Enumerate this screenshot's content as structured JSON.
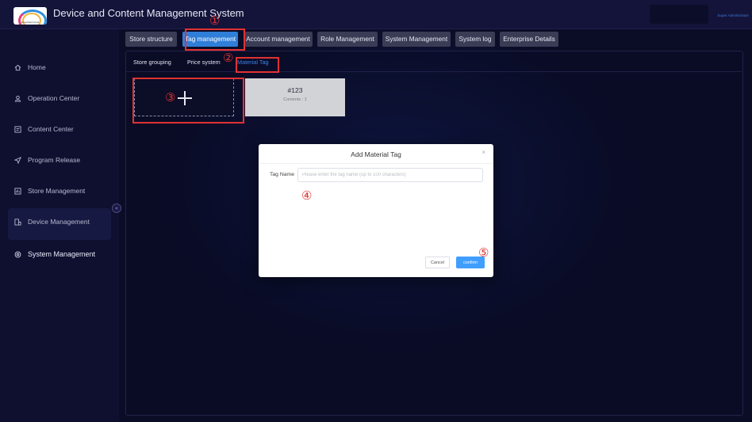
{
  "header": {
    "logo_text": "Greenfield Cloud",
    "title": "Device and Content Management System",
    "user_role": "Super Administrator"
  },
  "sidebar": {
    "items": [
      {
        "label": "Home",
        "icon": "home-icon"
      },
      {
        "label": "Operation Center",
        "icon": "operation-icon"
      },
      {
        "label": "Content Center",
        "icon": "content-icon"
      },
      {
        "label": "Program Release",
        "icon": "send-icon"
      },
      {
        "label": "Store Management",
        "icon": "store-icon"
      },
      {
        "label": "Device Management",
        "icon": "device-icon"
      },
      {
        "label": "System Management",
        "icon": "settings-icon",
        "active": true
      }
    ],
    "collapse_glyph": "«"
  },
  "tabs": [
    {
      "label": "Store structure"
    },
    {
      "label": "Tag management",
      "active": true
    },
    {
      "label": "Account management"
    },
    {
      "label": "Role Management"
    },
    {
      "label": "System Management"
    },
    {
      "label": "System log"
    },
    {
      "label": "Enterprise Details"
    }
  ],
  "subtabs": [
    {
      "label": "Store grouping"
    },
    {
      "label": "Price system"
    },
    {
      "label": "Material Tag",
      "active": true
    }
  ],
  "tags": [
    {
      "name": "#123",
      "count_label": "Contents : 1"
    }
  ],
  "dialog": {
    "title": "Add Material Tag",
    "close": "×",
    "field_label": "Tag Name",
    "field_placeholder": "Please enter the tag name (up to 100 characters)",
    "field_value": "",
    "cancel_label": "Cancel",
    "confirm_label": "confirm"
  },
  "annotations": [
    "①",
    "②",
    "③",
    "④",
    "⑤"
  ],
  "colors": {
    "accent": "#2f7ed8",
    "highlight": "#e03232",
    "primary_button": "#409eff"
  }
}
